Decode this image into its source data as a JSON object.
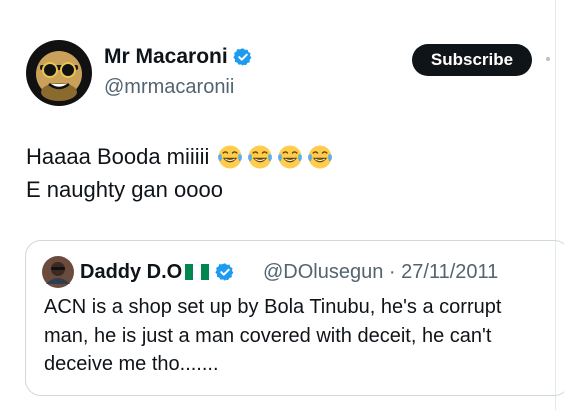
{
  "author": {
    "name": "Mr Macaroni",
    "handle": "@mrmacaronii",
    "verified": true
  },
  "subscribe_button": {
    "label": "Subscribe"
  },
  "tweet": {
    "lines": [
      "Haaaa Booda miiiii",
      "E naughty gan oooo"
    ],
    "emojis": [
      "face-with-tears-of-joy",
      "face-with-tears-of-joy",
      "face-with-tears-of-joy",
      "face-with-tears-of-joy"
    ]
  },
  "quoted_tweet": {
    "name": "Daddy D.O",
    "flag": "nigeria-flag",
    "verified": true,
    "meta": "@DOlusegun · 27/11/2011",
    "lines": [
      "ACN is a shop set up by Bola Tinubu, he's a corrupt",
      "man, he is just a man covered with deceit, he can't",
      "deceive me tho......."
    ]
  },
  "colors": {
    "text": "#0f1419",
    "secondary": "#536471",
    "verified_badge": "#1d9bf0",
    "subscribe_bg": "#0f1419",
    "card_border": "#cfd9de"
  }
}
